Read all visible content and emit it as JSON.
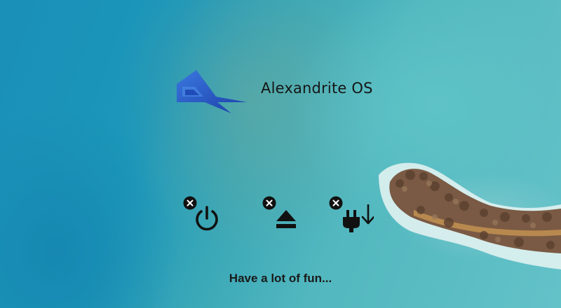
{
  "app": {
    "title": "Alexandrite OS",
    "tagline": "Have a lot of fun..."
  },
  "colors": {
    "logo_blue": "#2a5fd0",
    "logo_blue_dark": "#1c3fa8",
    "text": "#151515"
  },
  "actions": [
    {
      "icon": "power-icon",
      "close_icon": "close-circle-icon"
    },
    {
      "icon": "eject-icon",
      "close_icon": "close-circle-icon"
    },
    {
      "icon": "unplug-download-icon",
      "close_icon": "close-circle-icon"
    }
  ]
}
